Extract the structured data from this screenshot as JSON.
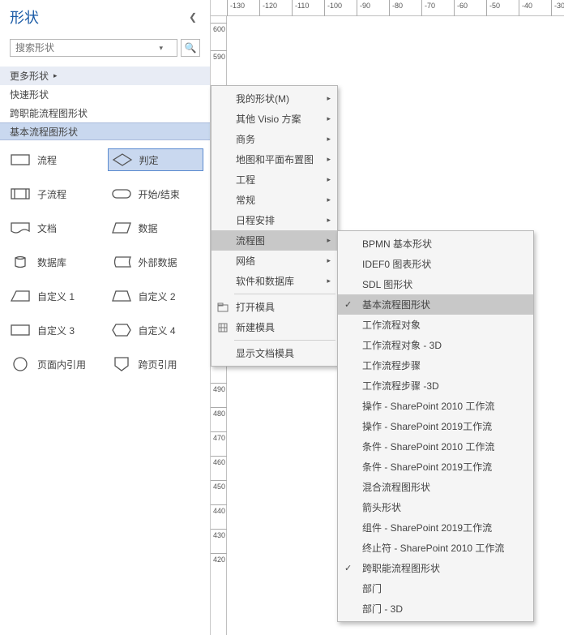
{
  "panel": {
    "title": "形状",
    "search_placeholder": "搜索形状",
    "rows": [
      {
        "label": "更多形状",
        "hover": true,
        "flyout": true
      },
      {
        "label": "快速形状"
      },
      {
        "label": "跨职能流程图形状"
      }
    ],
    "selected_header": "基本流程图形状",
    "shapes": [
      {
        "ico": "rect",
        "label": "流程"
      },
      {
        "ico": "diamond",
        "label": "判定",
        "sel": true
      },
      {
        "ico": "subproc",
        "label": "子流程"
      },
      {
        "ico": "startend",
        "label": "开始/结束"
      },
      {
        "ico": "doc",
        "label": "文档"
      },
      {
        "ico": "data",
        "label": "数据"
      },
      {
        "ico": "db",
        "label": "数据库"
      },
      {
        "ico": "extdb",
        "label": "外部数据"
      },
      {
        "ico": "cust1",
        "label": "自定义 1"
      },
      {
        "ico": "cust2",
        "label": "自定义 2"
      },
      {
        "ico": "cust3",
        "label": "自定义 3"
      },
      {
        "ico": "cust4",
        "label": "自定义 4"
      },
      {
        "ico": "onpage",
        "label": "页面内引用"
      },
      {
        "ico": "offpage",
        "label": "跨页引用"
      }
    ]
  },
  "ruler": {
    "h": [
      -130,
      -120,
      -110,
      -100,
      -90,
      -80,
      -70,
      -60,
      -50,
      -40,
      -30
    ],
    "v": [
      600,
      590,
      490,
      480,
      470,
      460,
      450,
      440,
      430,
      420
    ]
  },
  "menu1": [
    {
      "label": "我的形状(M)",
      "fly": true
    },
    {
      "label": "其他 Visio 方案",
      "fly": true
    },
    {
      "label": "商务",
      "fly": true
    },
    {
      "label": "地图和平面布置图",
      "fly": true
    },
    {
      "label": "工程",
      "fly": true
    },
    {
      "label": "常规",
      "fly": true
    },
    {
      "label": "日程安排",
      "fly": true
    },
    {
      "label": "流程图",
      "fly": true,
      "hover": true
    },
    {
      "label": "网络",
      "fly": true
    },
    {
      "label": "软件和数据库",
      "fly": true
    },
    {
      "sep": true
    },
    {
      "label": "打开模具",
      "ico": "open"
    },
    {
      "label": "新建模具",
      "ico": "new"
    },
    {
      "sep": true
    },
    {
      "label": "显示文档模具"
    }
  ],
  "menu2": [
    {
      "label": "BPMN 基本形状"
    },
    {
      "label": "IDEF0 图表形状"
    },
    {
      "label": "SDL 图形状"
    },
    {
      "label": "基本流程图形状",
      "ck": true,
      "hover": true
    },
    {
      "label": "工作流程对象"
    },
    {
      "label": "工作流程对象 - 3D"
    },
    {
      "label": "工作流程步骤"
    },
    {
      "label": "工作流程步骤 -3D"
    },
    {
      "label": "操作 - SharePoint 2010 工作流"
    },
    {
      "label": "操作 - SharePoint 2019工作流"
    },
    {
      "label": "条件 - SharePoint 2010 工作流"
    },
    {
      "label": "条件 - SharePoint 2019工作流"
    },
    {
      "label": "混合流程图形状"
    },
    {
      "label": "箭头形状"
    },
    {
      "label": "组件 - SharePoint 2019工作流"
    },
    {
      "label": "终止符 - SharePoint 2010 工作流"
    },
    {
      "label": "跨职能流程图形状",
      "ck": true
    },
    {
      "label": "部门"
    },
    {
      "label": "部门 - 3D"
    }
  ]
}
